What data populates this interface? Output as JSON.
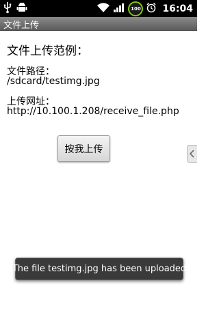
{
  "statusbar": {
    "time": "16:04",
    "battery_label": "100",
    "icons": [
      "usb-icon",
      "android-debug-icon",
      "wifi-icon",
      "signal-icon",
      "battery-icon",
      "alarm-icon"
    ]
  },
  "titlebar": {
    "title": "文件上传"
  },
  "main": {
    "heading": "文件上传范例：",
    "file_path_label": "文件路径：",
    "file_path_value": "/sdcard/testimg.jpg",
    "upload_url_label": "上传网址：",
    "upload_url_value": "http://10.100.1.208/receive_file.php",
    "upload_button_label": "按我上传"
  },
  "toast": {
    "message": "The file testimg.jpg has been uploaded"
  },
  "colors": {
    "statusbar_bg": "#000000",
    "titlebar_bg": "#6e6e6e",
    "toast_bg": "#3a3a3a",
    "battery_accent": "#7fc31c"
  }
}
